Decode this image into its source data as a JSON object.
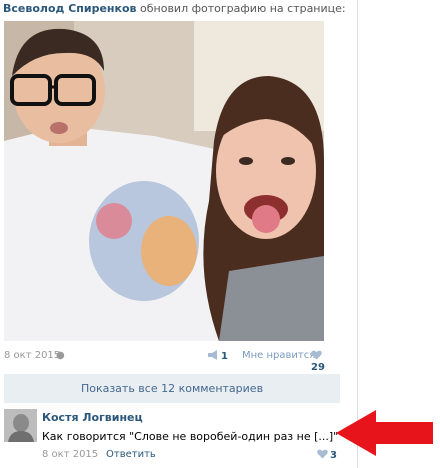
{
  "post": {
    "author": "Всеволод Спиренков",
    "action": "обновил фотографию на странице:",
    "date": "8 окт 2015",
    "device_icon": "apple-icon",
    "shares": "1",
    "like_label": "Мне нравится",
    "likes": "29"
  },
  "show_all_comments": "Показать все 12 комментариев",
  "comment": {
    "author": "Костя Логвинец",
    "text": "Как говорится \"Слове не воробей-один раз не [...]\"",
    "date": "8 окт 2015",
    "reply_label": "Ответить",
    "likes": "3"
  },
  "colors": {
    "link": "#2b587a",
    "muted": "#999999",
    "button_bg": "#e9eef3",
    "arrow": "#e8141b"
  }
}
